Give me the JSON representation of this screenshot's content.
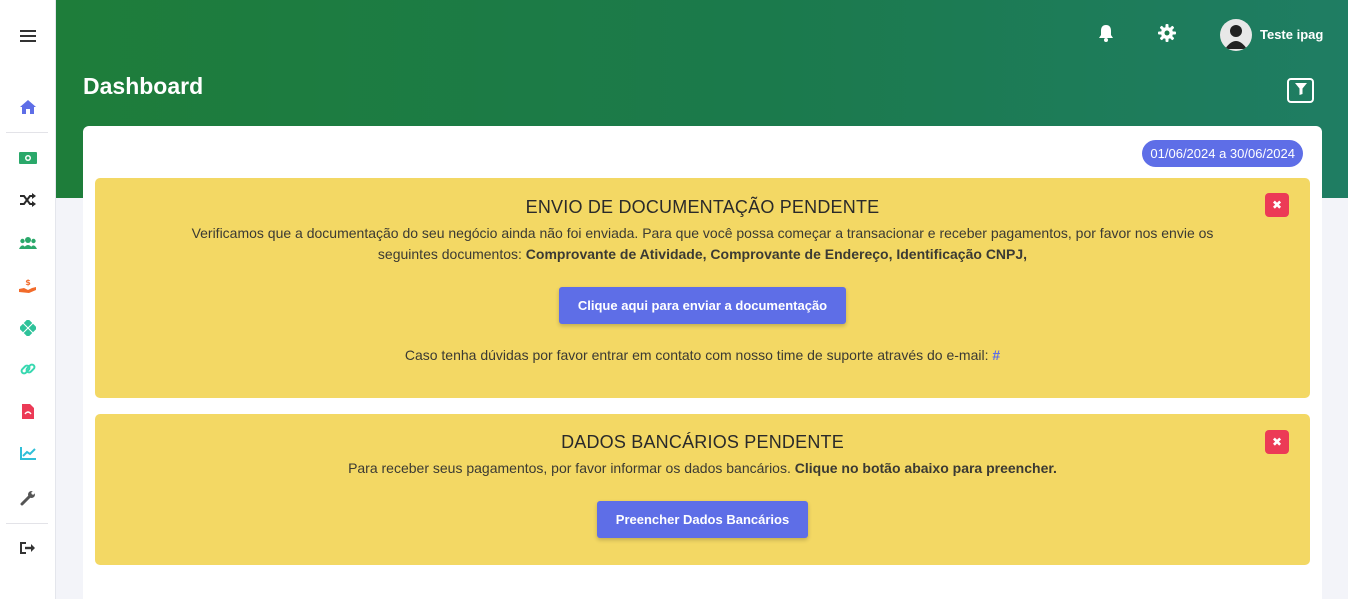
{
  "sidebar": {
    "items": [
      {
        "icon": "menu-icon",
        "color": "#333333"
      },
      {
        "icon": "home-icon",
        "color": "#5e6ee7"
      },
      {
        "icon": "money-icon",
        "color": "#2aa86a"
      },
      {
        "icon": "shuffle-icon",
        "color": "#2a2a2a"
      },
      {
        "icon": "users-icon",
        "color": "#2aa86a"
      },
      {
        "icon": "hand-dollar-icon",
        "color": "#f26b2a"
      },
      {
        "icon": "diamond-grid-icon",
        "color": "#2ec29a"
      },
      {
        "icon": "link-icon",
        "color": "#37d8b0"
      },
      {
        "icon": "pdf-file-icon",
        "color": "#ec3a56"
      },
      {
        "icon": "chart-line-icon",
        "color": "#2fbfd8"
      },
      {
        "icon": "wrench-icon",
        "color": "#555555"
      },
      {
        "icon": "logout-icon",
        "color": "#333333"
      }
    ]
  },
  "header": {
    "title": "Dashboard",
    "user_name": "Teste ipag",
    "icons": [
      "bell-icon",
      "gear-icon",
      "user-avatar-icon",
      "filter-icon"
    ]
  },
  "date_range": "01/06/2024 a 30/06/2024",
  "alert_docs": {
    "title": "ENVIO DE DOCUMENTAÇÃO PENDENTE",
    "text_line1": "Verificamos que a documentação do seu negócio ainda não foi enviada. Para que você possa começar a transacionar e receber pagamentos, por favor nos envie os",
    "text_line2_prefix": "seguintes documentos: ",
    "text_line2_bold": "Comprovante de Atividade, Comprovante de Endereço, Identificação CNPJ,",
    "button": "Clique aqui para enviar a documentação",
    "support_text": "Caso tenha dúvidas por favor entrar em contato com nosso time de suporte através do e-mail: ",
    "support_link": "#",
    "close": "✖"
  },
  "alert_bank": {
    "title": "DADOS BANCÁRIOS PENDENTE",
    "text_prefix": "Para receber seus pagamentos, por favor informar os dados bancários. ",
    "text_bold": "Clique no botão abaixo para preencher.",
    "button": "Preencher Dados Bancários",
    "close": "✖"
  },
  "colors": {
    "header_green": "#1e7d3a",
    "accent": "#5e6ee7",
    "alert_yellow": "#f3d864",
    "close_red": "#ec3a56"
  }
}
